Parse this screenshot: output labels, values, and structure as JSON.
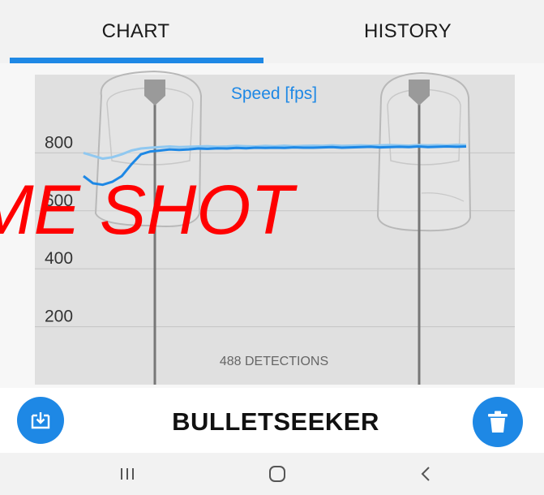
{
  "tabs": [
    {
      "label": "CHART",
      "selected": true
    },
    {
      "label": "HISTORY",
      "selected": false
    }
  ],
  "colors": {
    "accent": "#1e88e5",
    "series_main": "#1e88e5",
    "series_light": "#90c8f0",
    "watermark": "#ff0000",
    "plot_background": "#e0e0e0"
  },
  "chart_data": {
    "type": "line",
    "title": "Speed [fps]",
    "ylim": [
      0,
      1000
    ],
    "yticks": [
      200,
      400,
      600,
      800
    ],
    "grid": true,
    "series": [
      {
        "values": [
          720,
          695,
          690,
          700,
          720,
          760,
          795,
          805,
          808,
          812,
          810,
          812,
          815,
          814,
          816,
          815,
          817,
          816,
          818,
          817,
          818,
          817,
          819,
          818,
          818,
          819,
          820,
          818,
          819,
          820,
          821,
          819,
          820,
          821,
          820,
          822,
          820,
          821,
          822,
          821,
          822
        ]
      },
      {
        "values": [
          800,
          790,
          780,
          785,
          795,
          808,
          815,
          818,
          820,
          822,
          820,
          821,
          822,
          823,
          821,
          822,
          824,
          823,
          822,
          824,
          823,
          825,
          823,
          824,
          825,
          824,
          826,
          824,
          825,
          826,
          825,
          826,
          827,
          826,
          825,
          827,
          826,
          827,
          826,
          828,
          827
        ]
      }
    ],
    "annotation": "488 DETECTIONS"
  },
  "watermark_text": "ME SHOT",
  "app_title": "BULLETSEEKER",
  "icons": {
    "export": "download-tray-icon",
    "delete": "trash-icon",
    "nav_recent": "recent-apps-icon",
    "nav_home": "home-icon",
    "nav_back": "back-chevron-icon"
  }
}
